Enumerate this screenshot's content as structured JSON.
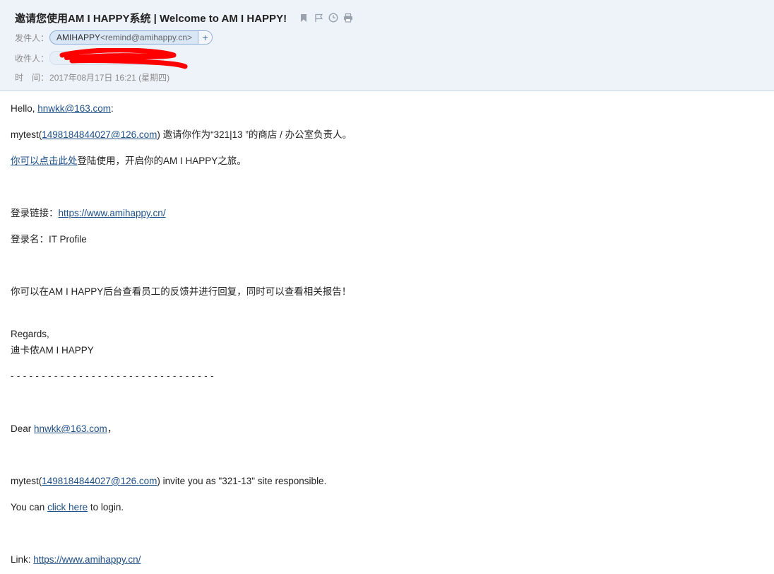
{
  "header": {
    "subject": "邀请您使用AM I HAPPY系统 | Welcome to AM I HAPPY!",
    "icons": [
      "bookmark-icon",
      "flag-icon",
      "clock-icon",
      "print-icon"
    ],
    "from_label": "发件人：",
    "sender_name": "AMIHAPPY",
    "sender_email": "<remind@amihappy.cn>",
    "add_contact": "+",
    "to_label": "收件人：",
    "time_label": "时　间：",
    "time_value": "2017年08月17日 16:21 (星期四)"
  },
  "body": {
    "hello_prefix": "Hello, ",
    "hello_email": "hnwkk@163.com",
    "hello_suffix": ":",
    "invite_cn_prefix": "mytest(",
    "inviter_email": "1498184844027@126.com",
    "invite_cn_suffix": ") 邀请你作为“321|13 ”的商店 / 办公室负责人。",
    "login_link_cn": "你可以点击此处",
    "login_suffix_cn": "登陆使用，开启你的AM I HAPPY之旅。",
    "link_label_cn": "登录链接：",
    "link_url": "https://www.amihappy.cn/",
    "login_name_label_cn": "登录名：",
    "login_name": "IT Profile",
    "feedback_cn": "你可以在AM I HAPPY后台查看员工的反馈并进行回复，同时可以查看相关报告！",
    "regards": "Regards,",
    "signature": "迪卡侬AM I HAPPY",
    "divider": "- - - - - - - - - - - - - - - - - - - - - - - - - - - - - - - - -",
    "dear_prefix": "Dear ",
    "dear_email": "hnwkk@163.com",
    "dear_suffix": "，",
    "invite_en_prefix": "mytest(",
    "invite_en_email": "1498184844027@126.com",
    "invite_en_suffix": ") invite you as \"321-13\" site responsible.",
    "you_can": "You can ",
    "click_here": "click here",
    "to_login": " to login.",
    "link_label_en": "Link: ",
    "link_url_en": "https://www.amihappy.cn/"
  },
  "colors": {
    "header_bg": "#eef3fa",
    "link": "#1e4f87",
    "redaction": "#ff0000"
  }
}
